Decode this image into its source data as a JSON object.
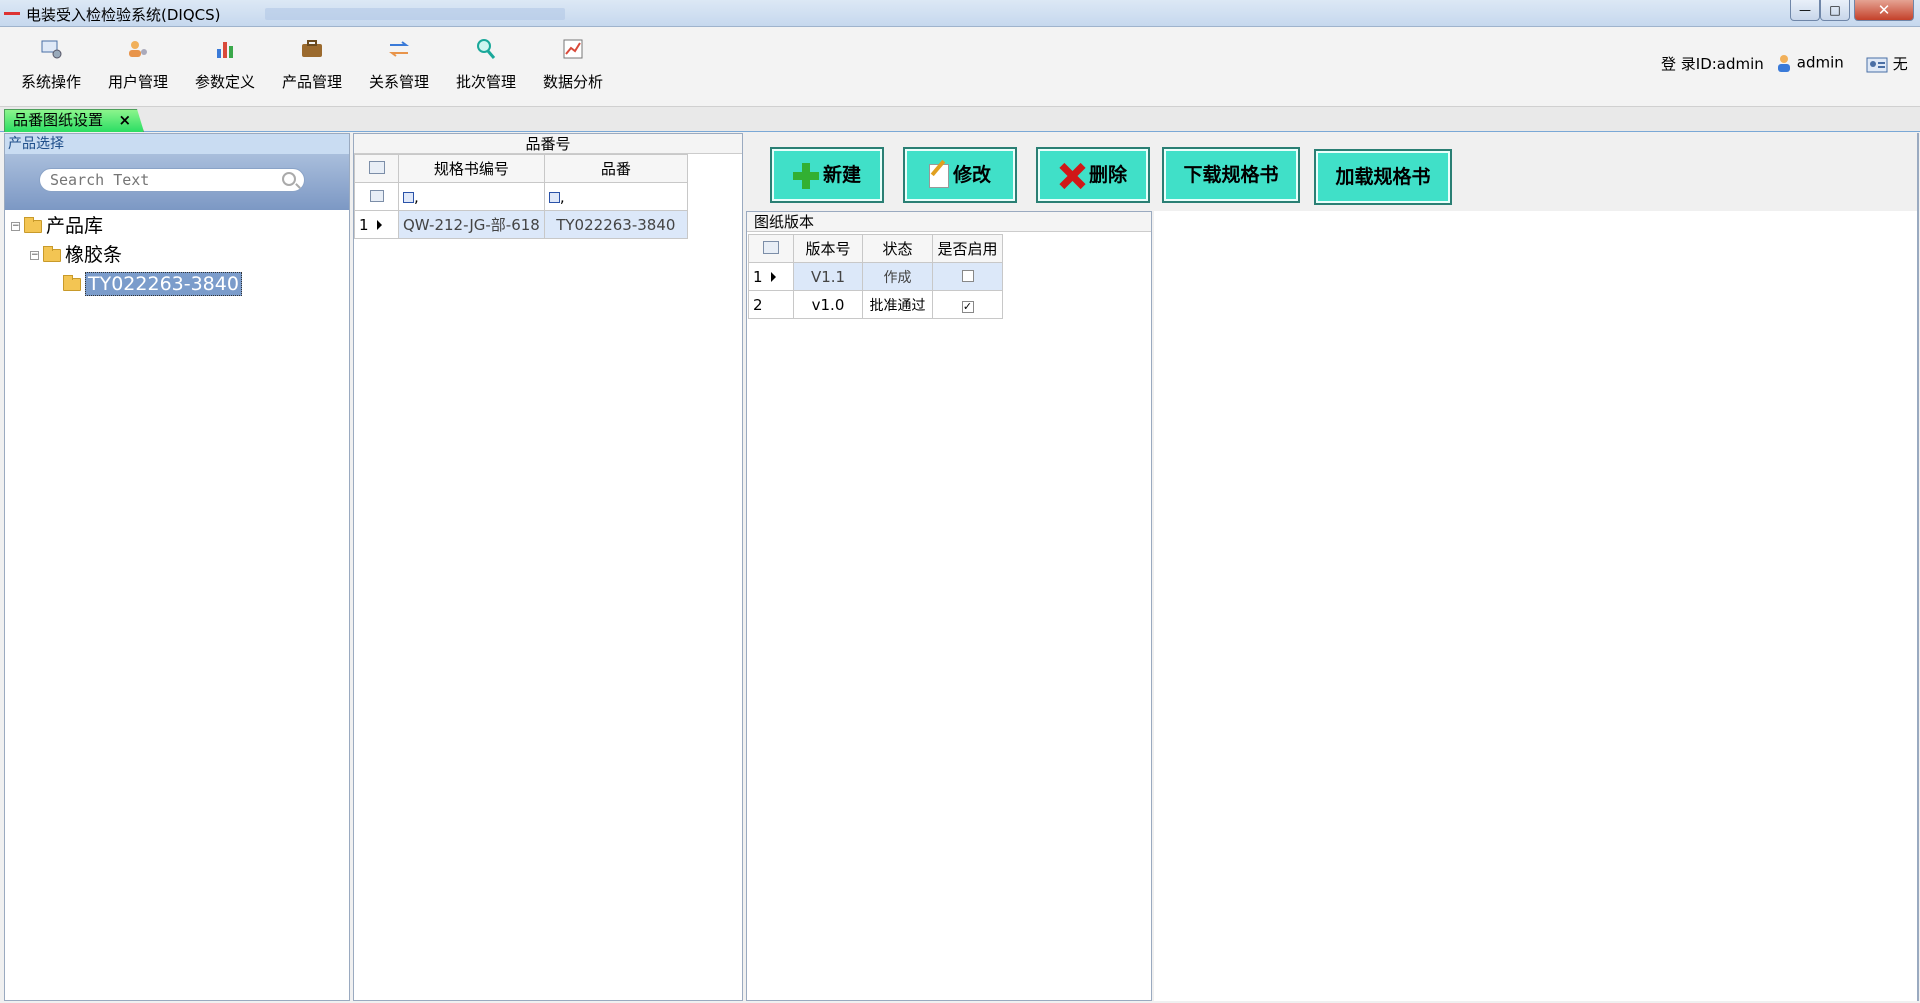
{
  "window": {
    "title": "电装受入检检验系统(DIQCS)",
    "min_glyph": "—",
    "max_glyph": "□",
    "close_glyph": "✕"
  },
  "toolbar": {
    "items": [
      {
        "label": "系统操作",
        "icon": "system-icon"
      },
      {
        "label": "用户管理",
        "icon": "users-icon"
      },
      {
        "label": "参数定义",
        "icon": "chart-icon"
      },
      {
        "label": "产品管理",
        "icon": "briefcase-icon"
      },
      {
        "label": "关系管理",
        "icon": "arrows-icon"
      },
      {
        "label": "批次管理",
        "icon": "search-icon"
      },
      {
        "label": "数据分析",
        "icon": "analysis-icon"
      }
    ],
    "login_label": "登 录ID:admin",
    "user_name": "admin",
    "status_text": "无"
  },
  "tab": {
    "label": "品番图纸设置",
    "close": "×"
  },
  "product_panel": {
    "header": "产品选择",
    "search_placeholder": "Search Text",
    "tree": {
      "root": "产品库",
      "child": "橡胶条",
      "leaf": "TY022263-3840",
      "collapse_glyph": "−"
    }
  },
  "part_panel": {
    "caption": "品番号",
    "columns": [
      "规格书编号",
      "品番"
    ],
    "filter_glyph": ",",
    "rows": [
      {
        "index": "1",
        "spec_no": "QW-212-JG-部-618",
        "part_no": "TY022263-3840"
      }
    ]
  },
  "actions": {
    "new": "新建",
    "edit": "修改",
    "delete": "删除",
    "download": "下载规格书",
    "load": "加载规格书"
  },
  "drawing_panel": {
    "caption": "图纸版本",
    "columns": [
      "版本号",
      "状态",
      "是否启用"
    ],
    "rows": [
      {
        "index": "1",
        "version": "V1.1",
        "status": "作成",
        "enabled": false,
        "check_glyph": ""
      },
      {
        "index": "2",
        "version": "v1.0",
        "status": "批准通过",
        "enabled": true,
        "check_glyph": "✓"
      }
    ]
  }
}
